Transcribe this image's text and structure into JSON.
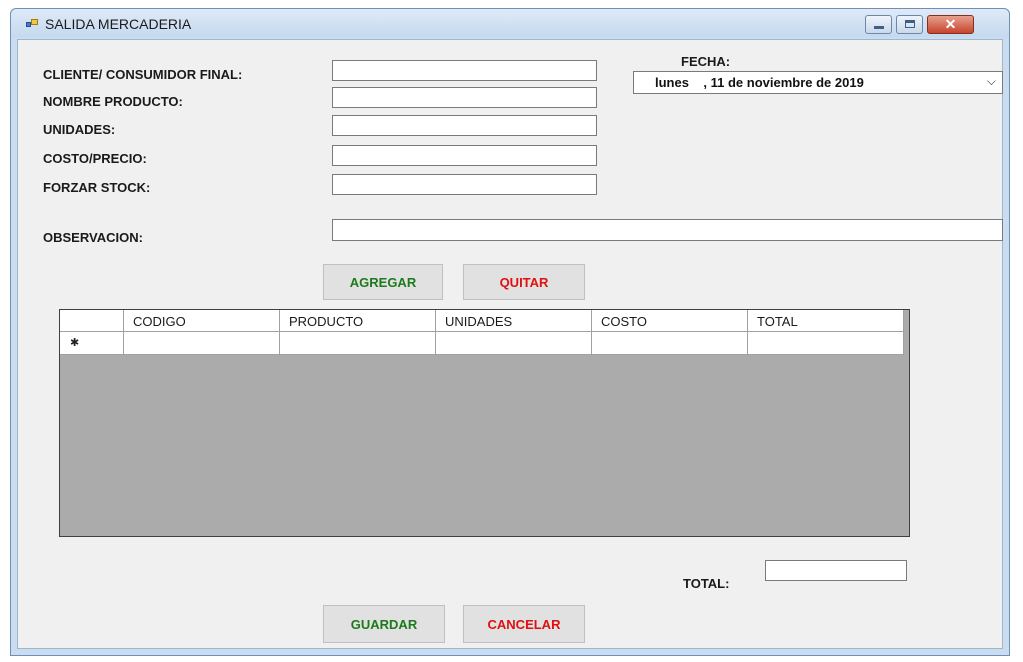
{
  "window": {
    "title": "SALIDA MERCADERIA",
    "controls": {
      "minimize": "minimize-icon",
      "maximize": "maximize-icon",
      "close": "close-icon"
    },
    "close_glyph": "✕"
  },
  "form": {
    "cliente_label": "CLIENTE/ CONSUMIDOR FINAL:",
    "cliente_value": "",
    "nombre_producto_label": "NOMBRE PRODUCTO:",
    "nombre_producto_value": "",
    "unidades_label": "UNIDADES:",
    "unidades_value": "",
    "costo_label": "COSTO/PRECIO:",
    "costo_value": "",
    "forzar_stock_label": "FORZAR STOCK:",
    "forzar_stock_value": "",
    "observacion_label": "OBSERVACION:",
    "observacion_value": ""
  },
  "fecha": {
    "label": "FECHA:",
    "value": "lunes    , 11 de noviembre de 2019",
    "dropdown_icon": "chevron-down-icon",
    "chevron": "⌵"
  },
  "actions": {
    "agregar": "AGREGAR",
    "quitar": "QUITAR",
    "guardar": "GUARDAR",
    "cancelar": "CANCELAR"
  },
  "grid": {
    "columns": [
      "CODIGO",
      "PRODUCTO",
      "UNIDADES",
      "COSTO",
      "TOTAL"
    ],
    "rows": [],
    "new_row_marker": "✱"
  },
  "totals": {
    "label": "TOTAL:",
    "value": ""
  },
  "colors": {
    "green_button_text": "#1c7a1c",
    "red_button_text": "#e01010",
    "grid_background": "#ababab"
  }
}
